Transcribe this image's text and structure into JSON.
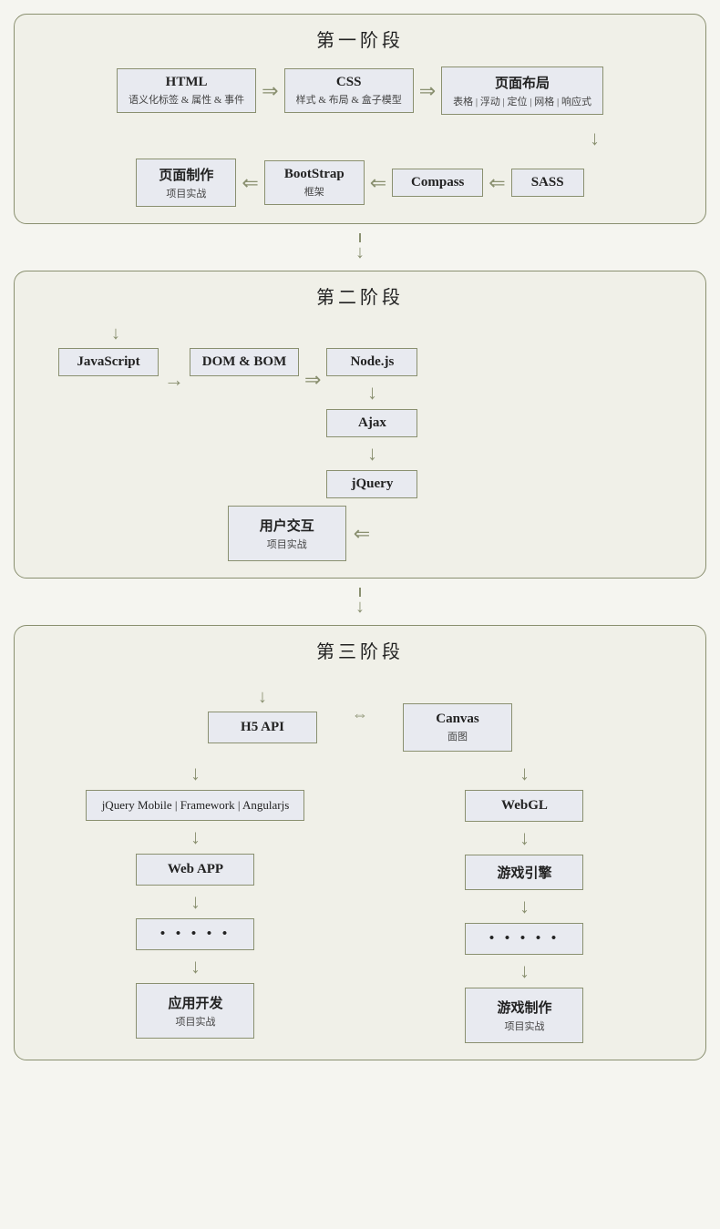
{
  "stage1": {
    "title": "第一阶段",
    "row1": [
      {
        "id": "html",
        "main": "HTML",
        "sub": "语义化标签 & 属性 & 事件"
      },
      {
        "id": "css",
        "main": "CSS",
        "sub": "样式 & 布局 & 盒子模型"
      },
      {
        "id": "layout",
        "main": "页面布局",
        "sub": "表格 | 浮动 | 定位 | 网格 | 响应式"
      }
    ],
    "row2": [
      {
        "id": "webpage",
        "main": "页面制作",
        "sub": "项目实战"
      },
      {
        "id": "bootstrap",
        "main": "BootStrap",
        "sub": "框架"
      },
      {
        "id": "compass",
        "main": "Compass",
        "sub": ""
      },
      {
        "id": "sass",
        "main": "SASS",
        "sub": ""
      }
    ]
  },
  "stage2": {
    "title": "第二阶段",
    "items": [
      {
        "id": "javascript",
        "main": "JavaScript",
        "sub": ""
      },
      {
        "id": "dombom",
        "main": "DOM & BOM",
        "sub": ""
      },
      {
        "id": "nodejs",
        "main": "Node.js",
        "sub": ""
      },
      {
        "id": "ajax",
        "main": "Ajax",
        "sub": ""
      },
      {
        "id": "jquery",
        "main": "jQuery",
        "sub": ""
      },
      {
        "id": "interaction",
        "main": "用户交互",
        "sub": "项目实战"
      }
    ]
  },
  "stage3": {
    "title": "第三阶段",
    "left": [
      {
        "id": "h5api",
        "main": "H5 API",
        "sub": ""
      },
      {
        "id": "mobile",
        "main": "jQuery Mobile | Framework | Angularjs",
        "sub": ""
      },
      {
        "id": "webapp",
        "main": "Web APP",
        "sub": ""
      },
      {
        "id": "dots1",
        "main": "• • • • •",
        "sub": ""
      },
      {
        "id": "appdev",
        "main": "应用开发",
        "sub": "项目实战"
      }
    ],
    "right": [
      {
        "id": "canvas",
        "main": "Canvas",
        "sub": "面图"
      },
      {
        "id": "webgl",
        "main": "WebGL",
        "sub": ""
      },
      {
        "id": "gameengine",
        "main": "游戏引擎",
        "sub": ""
      },
      {
        "id": "dots2",
        "main": "• • • • •",
        "sub": ""
      },
      {
        "id": "gamemake",
        "main": "游戏制作",
        "sub": "项目实战"
      }
    ]
  },
  "arrows": {
    "right": "→",
    "double_right": "⇒",
    "left": "←",
    "double_left": "⇐",
    "down": "↓",
    "double_down": "⇓",
    "double_both": "⇔"
  }
}
